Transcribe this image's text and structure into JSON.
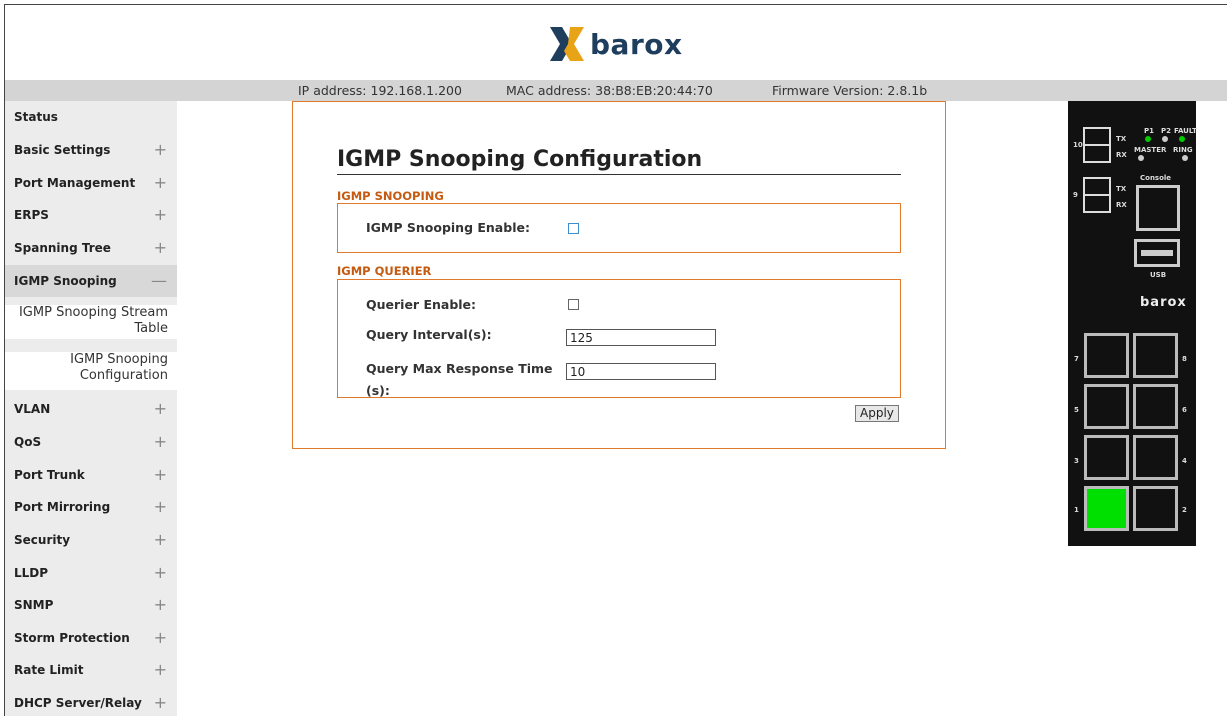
{
  "header": {
    "brand": "barox",
    "ip": "IP address: 192.168.1.200",
    "mac": "MAC address: 38:B8:EB:20:44:70",
    "firmware": "Firmware Version: 2.8.1b"
  },
  "sidebar": {
    "items": [
      {
        "label": "Status",
        "toggle": ""
      },
      {
        "label": "Basic Settings",
        "toggle": "+"
      },
      {
        "label": "Port Management",
        "toggle": "+"
      },
      {
        "label": "ERPS",
        "toggle": "+"
      },
      {
        "label": "Spanning Tree",
        "toggle": "+"
      },
      {
        "label": "IGMP Snooping",
        "toggle": "—"
      },
      {
        "label": "VLAN",
        "toggle": "+"
      },
      {
        "label": "QoS",
        "toggle": "+"
      },
      {
        "label": "Port Trunk",
        "toggle": "+"
      },
      {
        "label": "Port Mirroring",
        "toggle": "+"
      },
      {
        "label": "Security",
        "toggle": "+"
      },
      {
        "label": "LLDP",
        "toggle": "+"
      },
      {
        "label": "SNMP",
        "toggle": "+"
      },
      {
        "label": "Storm Protection",
        "toggle": "+"
      },
      {
        "label": "Rate Limit",
        "toggle": "+"
      },
      {
        "label": "DHCP Server/Relay",
        "toggle": "+"
      }
    ],
    "subitems": [
      {
        "line1": "IGMP Snooping Stream",
        "line2": "Table"
      },
      {
        "line1": "IGMP Snooping",
        "line2": "Configuration"
      }
    ]
  },
  "main": {
    "title": "IGMP Snooping Configuration",
    "snooping_section": "IGMP SNOOPING",
    "snooping_enable_label": "IGMP Snooping Enable:",
    "snooping_enable_checked": false,
    "querier_section": "IGMP QUERIER",
    "querier_enable_label": "Querier Enable:",
    "querier_enable_checked": false,
    "query_interval_label": "Query Interval(s):",
    "query_interval_value": "125",
    "query_max_label_line1": "Query Max Response Time",
    "query_max_label_line2": "(s):",
    "query_max_value": "10",
    "apply_label": "Apply"
  },
  "device": {
    "led_labels": [
      "P1",
      "P2",
      "FAULT",
      "MASTER",
      "RING"
    ],
    "console_label": "Console",
    "usb_label": "USB",
    "brand": "barox",
    "sfp_labels": [
      "10",
      "9"
    ],
    "sfp_tx_rx": [
      "TX",
      "RX"
    ],
    "port_numbers": [
      "7",
      "8",
      "5",
      "6",
      "3",
      "4",
      "1",
      "2"
    ],
    "active_port": "1",
    "led_color": "#00cc00"
  },
  "colors": {
    "accent": "#e07a2a",
    "section_text": "#c55a11",
    "brand": "#1f3d5c",
    "logo_x": "#e8a317"
  }
}
